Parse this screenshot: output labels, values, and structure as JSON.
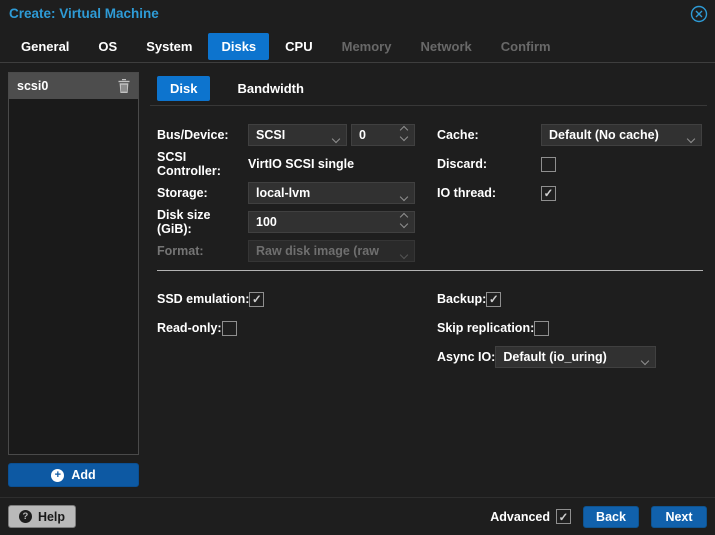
{
  "glyphs": {
    "check": "✓",
    "plus": "+",
    "question": "?"
  },
  "window": {
    "title": "Create: Virtual Machine"
  },
  "tabs": [
    {
      "label": "General",
      "state": "normal"
    },
    {
      "label": "OS",
      "state": "normal"
    },
    {
      "label": "System",
      "state": "normal"
    },
    {
      "label": "Disks",
      "state": "active"
    },
    {
      "label": "CPU",
      "state": "normal"
    },
    {
      "label": "Memory",
      "state": "disabled"
    },
    {
      "label": "Network",
      "state": "disabled"
    },
    {
      "label": "Confirm",
      "state": "disabled"
    }
  ],
  "disk_panel": {
    "selected_item": "scsi0",
    "add_button": "Add"
  },
  "subtabs": {
    "disk": "Disk",
    "bandwidth": "Bandwidth"
  },
  "disk_form": {
    "bus_device_label": "Bus/Device:",
    "bus_value": "SCSI",
    "device_number": "0",
    "controller_label": "SCSI Controller:",
    "controller_value": "VirtIO SCSI single",
    "storage_label": "Storage:",
    "storage_value": "local-lvm",
    "disk_size_label": "Disk size (GiB):",
    "disk_size_value": "100",
    "format_label": "Format:",
    "format_value": "Raw disk image (raw",
    "cache_label": "Cache:",
    "cache_value": "Default (No cache)",
    "discard_label": "Discard:",
    "discard_checked": false,
    "io_thread_label": "IO thread:",
    "io_thread_checked": true,
    "ssd_emulation_label": "SSD emulation:",
    "ssd_emulation_checked": true,
    "read_only_label": "Read-only:",
    "read_only_checked": false,
    "backup_label": "Backup:",
    "backup_checked": true,
    "skip_replication_label": "Skip replication:",
    "skip_replication_checked": false,
    "async_io_label": "Async IO:",
    "async_io_value": "Default (io_uring)"
  },
  "footer": {
    "help_button": "Help",
    "advanced_label": "Advanced",
    "advanced_checked": true,
    "back_button": "Back",
    "next_button": "Next"
  },
  "colors": {
    "title_blue": "#2e9bd6",
    "active_tab_blue": "#0d74ce",
    "button_blue": "#1161ac",
    "add_button_blue": "#0d59a3",
    "window_bg": "#1e1e1e",
    "field_bg": "#313131",
    "selected_row_bg": "#4d4d4d"
  }
}
